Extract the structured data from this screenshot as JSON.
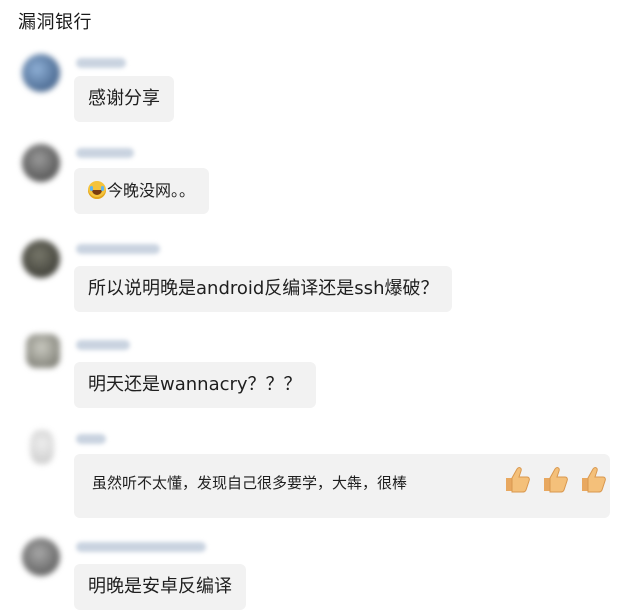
{
  "header": {
    "title": "漏洞银行"
  },
  "messages": [
    {
      "text": "感谢分享",
      "avatar_color": "#4a6a92",
      "emoji": ""
    },
    {
      "text": "今晚没网。。",
      "avatar_color": "#6a6a6a",
      "emoji": "laughing-crying"
    },
    {
      "text": "所以说明晚是android反编译还是ssh爆破？",
      "avatar_color": "#4a4a42",
      "emoji": ""
    },
    {
      "text": "明天还是wannacry？？？",
      "avatar_color": "#8a8a80",
      "emoji": ""
    },
    {
      "text": "虽然听不太懂，发现自己很多要学，大犇，很棒",
      "avatar_color": "#d5d5d5",
      "emoji": "thumbs-up x3"
    },
    {
      "text": "明晚是安卓反编译",
      "avatar_color": "#7a7a7a",
      "emoji": ""
    }
  ],
  "colors": {
    "bubble_bg": "#f2f2f2",
    "name_blur": "#c9d3e0",
    "thumb": "#f4c07a"
  }
}
